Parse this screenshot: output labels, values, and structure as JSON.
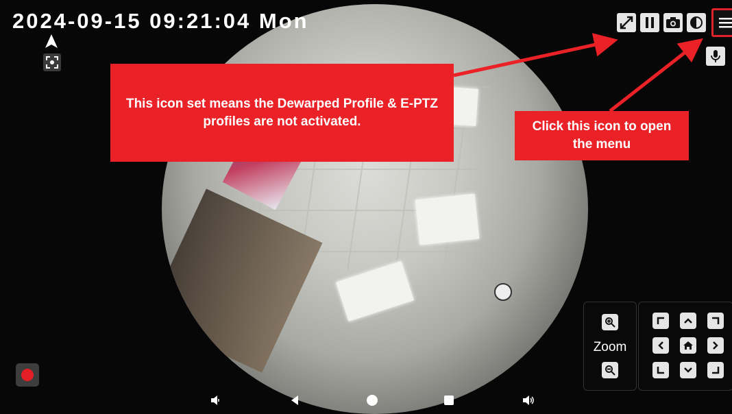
{
  "datetime": "2024-09-15  09:21:04 Mon",
  "top_left": {
    "navigation_icon": "navigation-arrow-icon",
    "focus_icon": "capture-focus-icon"
  },
  "toolbar": {
    "items": [
      {
        "name": "dewarp-off-icon",
        "glyph": "⤢"
      },
      {
        "name": "pause-icon",
        "glyph": "❚❚"
      },
      {
        "name": "camera-icon",
        "glyph": "📷"
      },
      {
        "name": "night-mode-icon",
        "glyph": "◐"
      }
    ],
    "menu": {
      "name": "menu-icon",
      "glyph": "≡"
    },
    "mic": {
      "name": "microphone-icon",
      "glyph": "🎤"
    }
  },
  "callouts": {
    "left": "This icon set means the Dewarped Profile & E-PTZ profiles are not activated.",
    "right": "Click this icon to open the menu"
  },
  "zoom": {
    "label": "Zoom",
    "in_icon": "zoom-in-icon",
    "out_icon": "zoom-out-icon"
  },
  "ptz": {
    "buttons": [
      "top-left-corner-icon",
      "up-icon",
      "top-right-corner-icon",
      "left-icon",
      "home-icon",
      "right-icon",
      "bottom-left-corner-icon",
      "down-icon",
      "bottom-right-corner-icon"
    ]
  },
  "bottom_bar": {
    "items": [
      "volume-down-icon",
      "back-icon",
      "home-icon",
      "recent-apps-icon",
      "volume-up-icon"
    ]
  },
  "colors": {
    "accent": "#ea2227",
    "background": "#070707",
    "icon_bg": "#e5e5e5"
  }
}
